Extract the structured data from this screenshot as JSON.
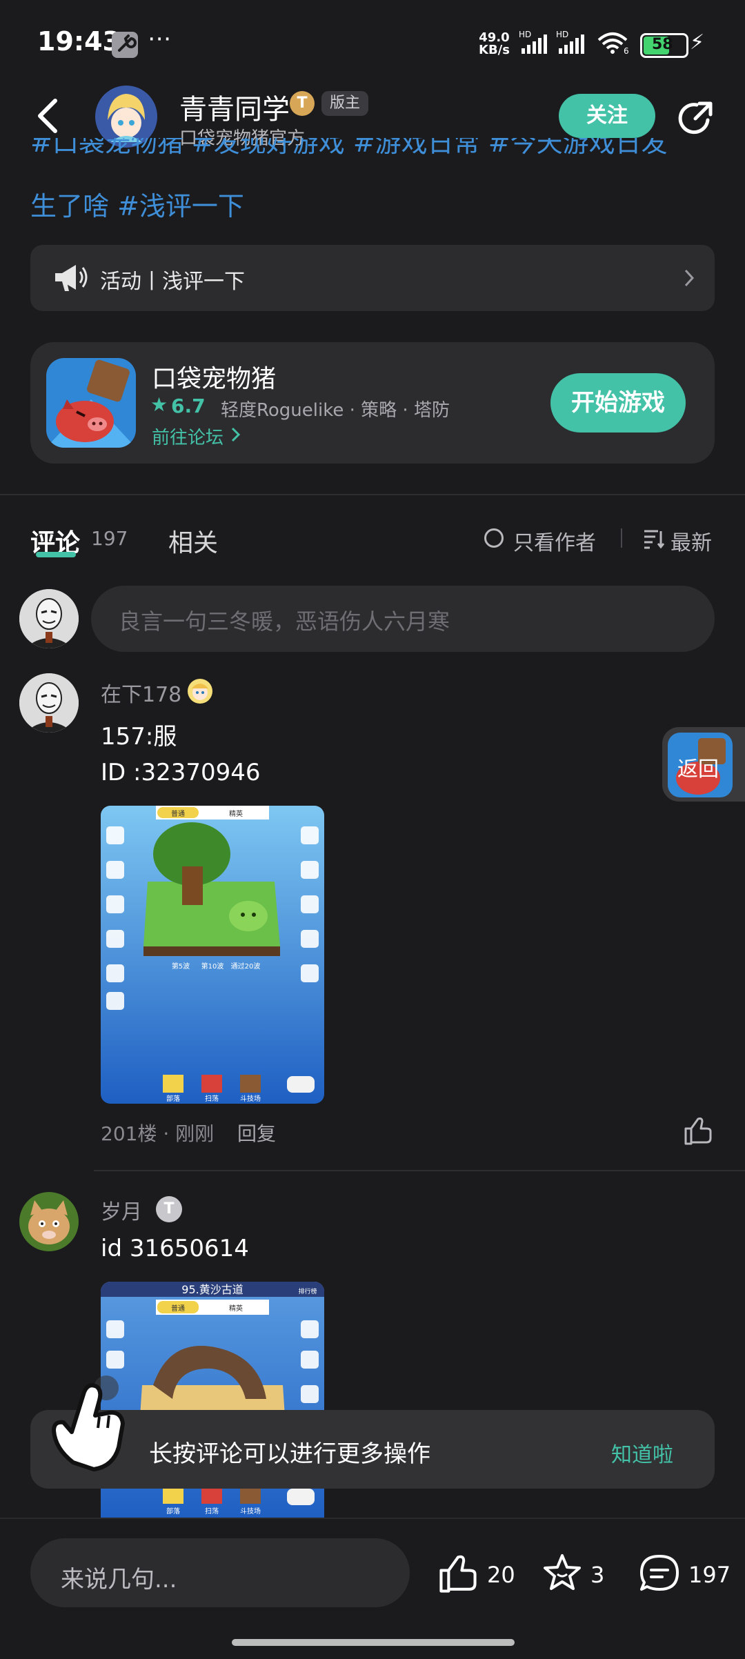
{
  "status_bar": {
    "time": "19:43",
    "net_speed_value": "49.0",
    "net_speed_unit": "KB/s",
    "hd1": "HD",
    "hd2": "HD",
    "battery": "58"
  },
  "header": {
    "name": "青青同学",
    "sub": "口袋宠物猪官方",
    "badge_letter": "T",
    "badge_mod": "版主",
    "follow_label": "关注"
  },
  "post": {
    "tags_cut": "#口袋宠物猪 #发现好游戏 #游戏日常 #今天游戏日发",
    "tags_line2": "生了啥 #浅评一下"
  },
  "activity": {
    "label": "活动丨浅评一下"
  },
  "game": {
    "name": "口袋宠物猪",
    "rating": "6.7",
    "tags": "轻度Roguelike · 策略 · 塔防",
    "forum": "前往论坛",
    "start_label": "开始游戏"
  },
  "tabs": {
    "comments": "评论",
    "comments_count": "197",
    "related": "相关",
    "only_author": "只看作者",
    "sort": "最新"
  },
  "comment_input": {
    "placeholder": "良言一句三冬暖，恶语伤人六月寒"
  },
  "comments": [
    {
      "user": "在下178",
      "line1": "157:服",
      "line2": "ID :32370946",
      "meta": "201楼 · 刚刚",
      "reply": "回复"
    },
    {
      "user": "岁月",
      "user_badge": "T",
      "line1": "id    31650614",
      "image_title": "95.黄沙古道"
    }
  ],
  "game_screenshot": {
    "mode_normal": "普通",
    "mode_elite": "精英",
    "btn_base": "部落",
    "btn_sweep": "扫荡",
    "btn_arena": "斗技场",
    "stage5": "第5波",
    "stage10": "第10波",
    "stage20": "通过20波",
    "ranking": "排行榜"
  },
  "float_back": {
    "label": "返回"
  },
  "toast": {
    "text": "长按评论可以进行更多操作",
    "ack": "知道啦"
  },
  "bottom_bar": {
    "placeholder": "来说几句...",
    "likes": "20",
    "favorites": "3",
    "comments": "197"
  },
  "colors": {
    "accent": "#43c2a8",
    "background": "#1b1b1d",
    "card": "#2c2c2f",
    "link": "#3f8ed8"
  }
}
